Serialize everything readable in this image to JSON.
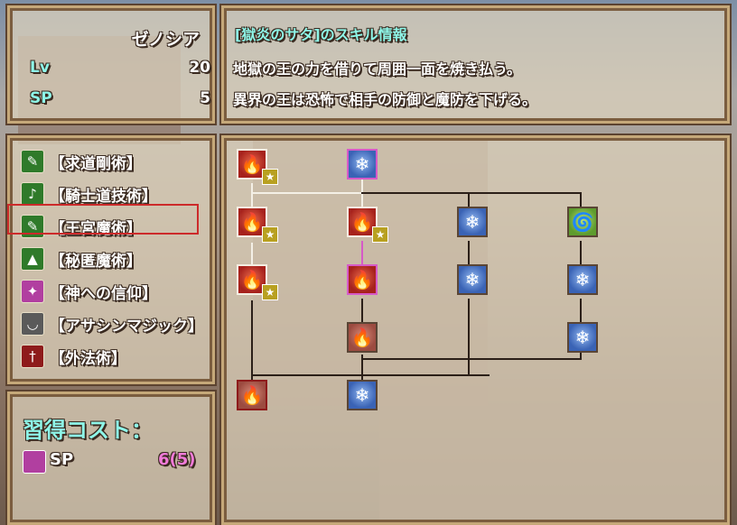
{
  "character": {
    "name": "ゼノシア",
    "lv_label": "Lv",
    "lv_value": "20",
    "sp_label": "SP",
    "sp_value": "5"
  },
  "skill_info": {
    "title": "[獄炎のサタ]のスキル情報",
    "line1": "地獄の王の力を借りて周囲一面を焼き払う。",
    "line2": "異界の王は恐怖で相手の防御と魔防を下げる。"
  },
  "categories": [
    {
      "label": "【求道剛術】",
      "icon": "book-icon",
      "color": "#2f7a2a"
    },
    {
      "label": "【騎士道技術】",
      "icon": "bell-icon",
      "color": "#2f7a2a"
    },
    {
      "label": "【王宮魔術】",
      "icon": "book-icon",
      "color": "#2f7a2a"
    },
    {
      "label": "【秘匿魔術】",
      "icon": "witch-hat-icon",
      "color": "#2f7a2a"
    },
    {
      "label": "【神への信仰】",
      "icon": "sparkle-icon",
      "color": "#b13fa0"
    },
    {
      "label": "【アサシンマジック】",
      "icon": "eye-icon",
      "color": "#5a5a5a"
    },
    {
      "label": "【外法術】",
      "icon": "dagger-icon",
      "color": "#8e1b1b"
    }
  ],
  "selected_category_index": 2,
  "cost": {
    "title": "習得コスト：",
    "sp_label": "SP",
    "value": "6(5)"
  },
  "colors": {
    "frame": "#c5a879",
    "fire": "#a6211c",
    "ice": "#3a63b5",
    "wind": "#5e9c2e",
    "highlight": "#d65ac8",
    "select": "#cc2a2a"
  },
  "tree": {
    "fire_icon": "🔥",
    "ice_icon": "❄",
    "wind_icon": "🌀",
    "star": "★"
  }
}
